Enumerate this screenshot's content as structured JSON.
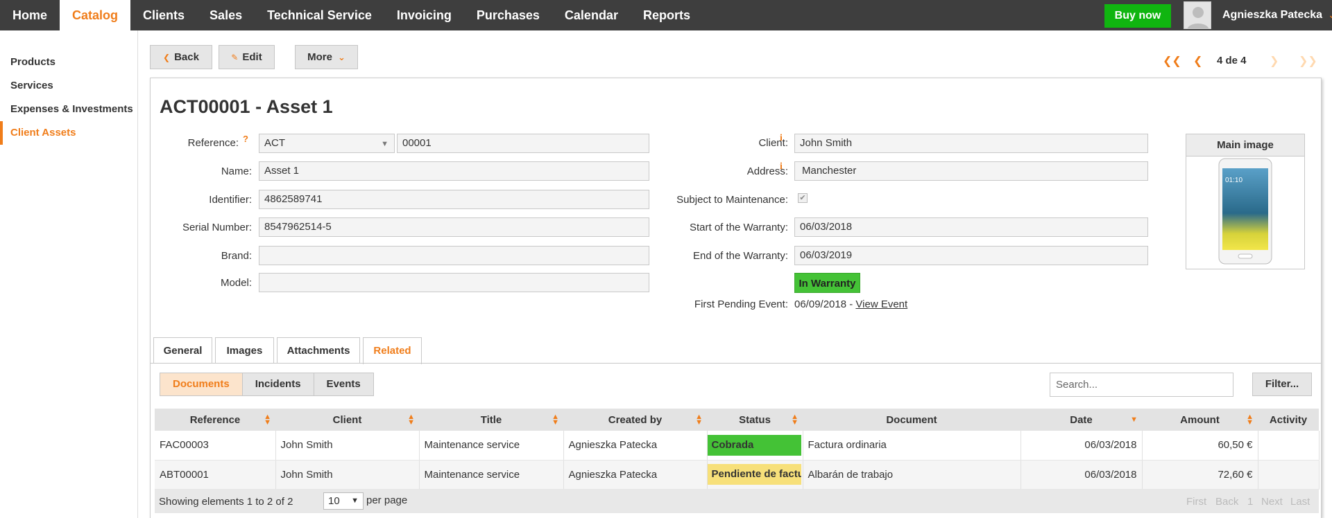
{
  "nav": {
    "items": [
      "Home",
      "Catalog",
      "Clients",
      "Sales",
      "Technical Service",
      "Invoicing",
      "Purchases",
      "Calendar",
      "Reports"
    ],
    "active": "Catalog",
    "buy_now": "Buy now",
    "user_name": "Agnieszka Patecka"
  },
  "sidebar": {
    "items": [
      "Products",
      "Services",
      "Expenses & Investments",
      "Client Assets"
    ],
    "active": "Client Assets"
  },
  "toolbar": {
    "back": "Back",
    "edit": "Edit",
    "more": "More",
    "pager_count": "4 de 4"
  },
  "asset": {
    "title": "ACT00001 - Asset 1",
    "labels": {
      "reference": "Reference:",
      "name": "Name:",
      "identifier": "Identifier:",
      "serial": "Serial Number:",
      "brand": "Brand:",
      "model": "Model:",
      "client": "Client:",
      "address": "Address:",
      "subject_maintenance": "Subject to Maintenance:",
      "warranty_start": "Start of the Warranty:",
      "warranty_end": "End of the Warranty:",
      "first_pending": "First Pending Event:"
    },
    "values": {
      "reference_prefix": "ACT",
      "reference_number": "00001",
      "name": "Asset 1",
      "identifier": "4862589741",
      "serial": "8547962514-5",
      "brand": "",
      "model": "",
      "client": "John Smith",
      "address": "Manchester",
      "subject_maintenance": true,
      "warranty_start": "06/03/2018",
      "warranty_end": "06/03/2019",
      "warranty_status": "In Warranty",
      "first_pending_date": "06/09/2018 - ",
      "view_event": "View Event"
    },
    "main_image_label": "Main image",
    "phone_time": "01:10"
  },
  "tabs": [
    "General",
    "Images",
    "Attachments",
    "Related"
  ],
  "active_tab": "Related",
  "subtabs": [
    "Documents",
    "Incidents",
    "Events"
  ],
  "active_subtab": "Documents",
  "search_placeholder": "Search...",
  "filter_label": "Filter...",
  "table": {
    "columns": [
      "Reference",
      "Client",
      "Title",
      "Created by",
      "Status",
      "Document",
      "Date",
      "Amount",
      "Activity"
    ],
    "rows": [
      {
        "reference": "FAC00003",
        "client": "John Smith",
        "title": "Maintenance service",
        "created_by": "Agnieszka Patecka",
        "status": "Cobrada",
        "status_color": "#44c236",
        "document": "Factura ordinaria",
        "date": "06/03/2018",
        "amount": "60,50 €",
        "activity": ""
      },
      {
        "reference": "ABT00001",
        "client": "John Smith",
        "title": "Maintenance service",
        "created_by": "Agnieszka Patecka",
        "status": "Pendiente de factu",
        "status_color": "#f7e07a",
        "document": "Albarán de trabajo",
        "date": "06/03/2018",
        "amount": "72,60 €",
        "activity": ""
      }
    ]
  },
  "footer": {
    "showing": "Showing elements 1 to 2 of 2",
    "per_page_value": "10",
    "per_page_label": "per page",
    "first": "First",
    "back": "Back",
    "page": "1",
    "next": "Next",
    "last": "Last"
  },
  "colors": {
    "accent": "#f07d1a",
    "nav_bg": "#3e3e3e",
    "buy_now": "#10b510"
  }
}
